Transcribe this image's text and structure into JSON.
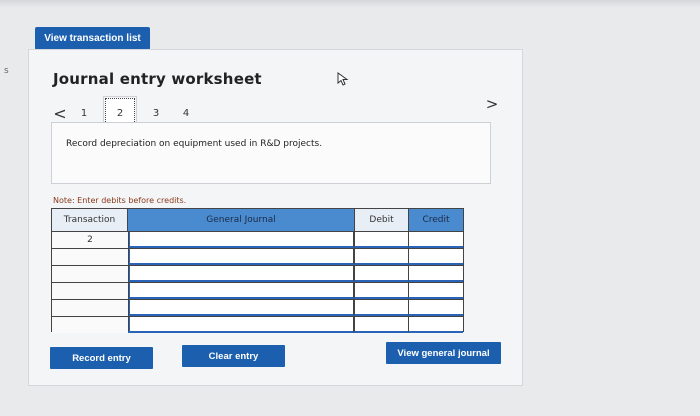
{
  "top_button": {
    "label": "View transaction list"
  },
  "worksheet": {
    "title": "Journal entry worksheet",
    "pager": {
      "prev_glyph": "<",
      "next_glyph": ">",
      "pages": [
        "1",
        "2",
        "3",
        "4"
      ],
      "active_page": "2"
    },
    "instruction": "Record depreciation on equipment used in R&D projects.",
    "note": "Note: Enter debits before credits."
  },
  "table": {
    "headers": {
      "transaction": "Transaction",
      "general_journal": "General Journal",
      "debit": "Debit",
      "credit": "Credit"
    },
    "rows": [
      {
        "transaction": "2",
        "general_journal": "",
        "debit": "",
        "credit": ""
      },
      {
        "transaction": "",
        "general_journal": "",
        "debit": "",
        "credit": ""
      },
      {
        "transaction": "",
        "general_journal": "",
        "debit": "",
        "credit": ""
      },
      {
        "transaction": "",
        "general_journal": "",
        "debit": "",
        "credit": ""
      },
      {
        "transaction": "",
        "general_journal": "",
        "debit": "",
        "credit": ""
      },
      {
        "transaction": "",
        "general_journal": "",
        "debit": "",
        "credit": ""
      }
    ]
  },
  "buttons": {
    "record_entry": "Record entry",
    "clear_entry": "Clear entry",
    "view_general_journal": "View general journal"
  },
  "colors": {
    "button_blue": "#1c5fae",
    "header_blue": "#4a8bd0",
    "note_text": "#8a3a1c"
  }
}
